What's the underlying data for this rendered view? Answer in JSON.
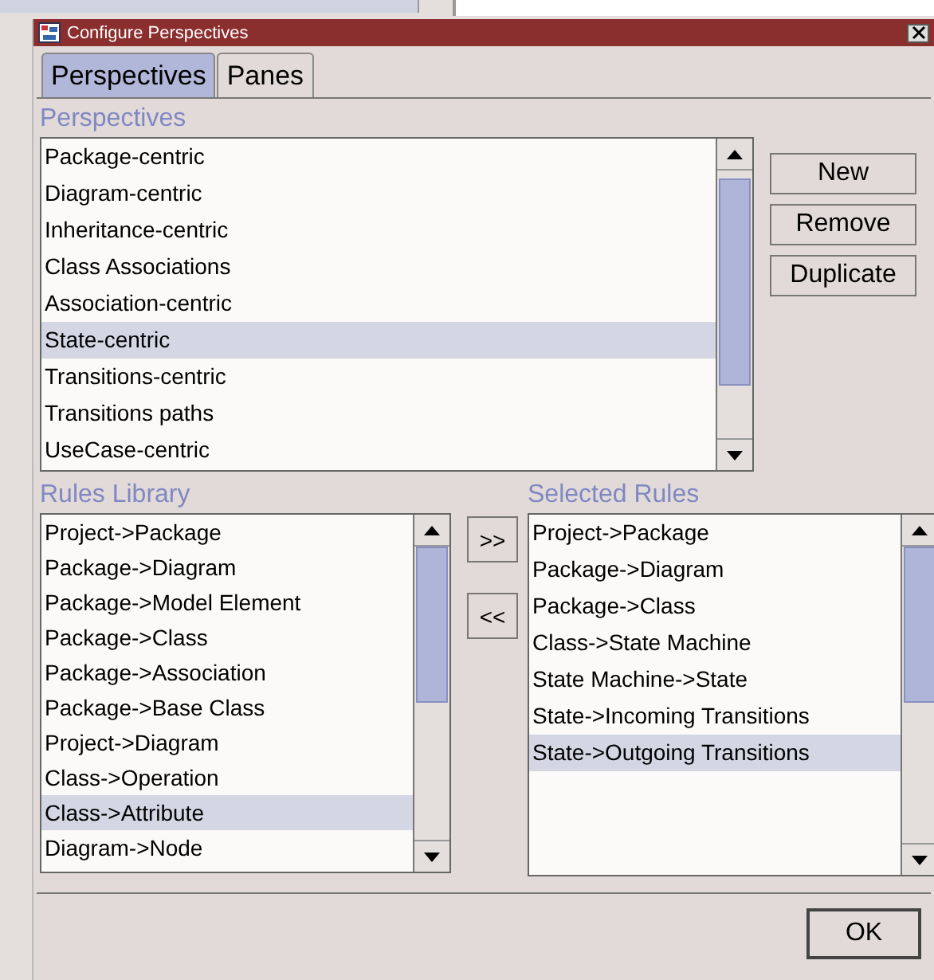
{
  "window": {
    "title": "Configure Perspectives"
  },
  "tabs": [
    {
      "label": "Perspectives",
      "selected": true
    },
    {
      "label": "Panes",
      "selected": false
    }
  ],
  "perspectives": {
    "label": "Perspectives",
    "items": [
      {
        "label": "Package-centric",
        "selected": false
      },
      {
        "label": "Diagram-centric",
        "selected": false
      },
      {
        "label": "Inheritance-centric",
        "selected": false
      },
      {
        "label": "Class Associations",
        "selected": false
      },
      {
        "label": "Association-centric",
        "selected": false
      },
      {
        "label": "State-centric",
        "selected": true
      },
      {
        "label": "Transitions-centric",
        "selected": false
      },
      {
        "label": "Transitions paths",
        "selected": false
      },
      {
        "label": "UseCase-centric",
        "selected": false
      }
    ]
  },
  "perspective_buttons": [
    "New",
    "Remove",
    "Duplicate"
  ],
  "rules_library": {
    "label": "Rules Library",
    "items": [
      {
        "label": "Project->Package",
        "selected": false
      },
      {
        "label": "Package->Diagram",
        "selected": false
      },
      {
        "label": "Package->Model Element",
        "selected": false
      },
      {
        "label": "Package->Class",
        "selected": false
      },
      {
        "label": "Package->Association",
        "selected": false
      },
      {
        "label": "Package->Base Class",
        "selected": false
      },
      {
        "label": "Project->Diagram",
        "selected": false
      },
      {
        "label": "Class->Operation",
        "selected": false
      },
      {
        "label": "Class->Attribute",
        "selected": true
      },
      {
        "label": "Diagram->Node",
        "selected": false
      }
    ]
  },
  "move_buttons": [
    ">>",
    "<<"
  ],
  "selected_rules": {
    "label": "Selected Rules",
    "items": [
      {
        "label": "Project->Package",
        "selected": false
      },
      {
        "label": "Package->Diagram",
        "selected": false
      },
      {
        "label": "Package->Class",
        "selected": false
      },
      {
        "label": "Class->State Machine",
        "selected": false
      },
      {
        "label": "State Machine->State",
        "selected": false
      },
      {
        "label": "State->Incoming Transitions",
        "selected": false
      },
      {
        "label": "State->Outgoing Transitions",
        "selected": true
      }
    ]
  },
  "ok_button": "OK"
}
